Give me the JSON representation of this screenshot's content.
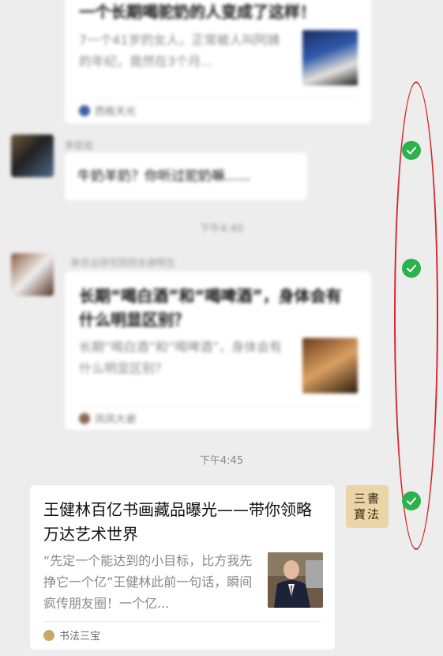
{
  "messages": [
    {
      "type": "article",
      "title": "一个长期喝驼奶的人变成了这样！",
      "desc": "7一个41岁的女人，正常被人叫阿姨的年纪，竟然在3个月...",
      "source": "西瓶天光"
    },
    {
      "type": "text",
      "sender": "李昆岩",
      "text": "牛奶羊奶？你听过驼奶嘛......"
    },
    {
      "type": "time",
      "text": "下午4:40"
    },
    {
      "type": "article",
      "sender": "新农业研究院院长谢明生",
      "title": "长期“喝白酒”和“喝啤酒”，身体会有什么明显区别？",
      "desc": "长期“喝白酒”和“喝啤酒”，身体会有什么明显区别？",
      "source": "凤凤大谢"
    },
    {
      "type": "time",
      "text": "下午4:45"
    },
    {
      "type": "article",
      "title": "王健林百亿书画藏品曝光——带你领略万达艺术世界",
      "desc": "“先定一个能达到的小目标，比方我先挣它一个亿”王健林此前一句话，瞬间疯传朋友圈！一个亿...",
      "source": "书法三宝",
      "avatar_text": "三書 寶法"
    }
  ],
  "colors": {
    "background": "#ededed",
    "check": "#2bb24c",
    "annotation": "#d7262e"
  }
}
